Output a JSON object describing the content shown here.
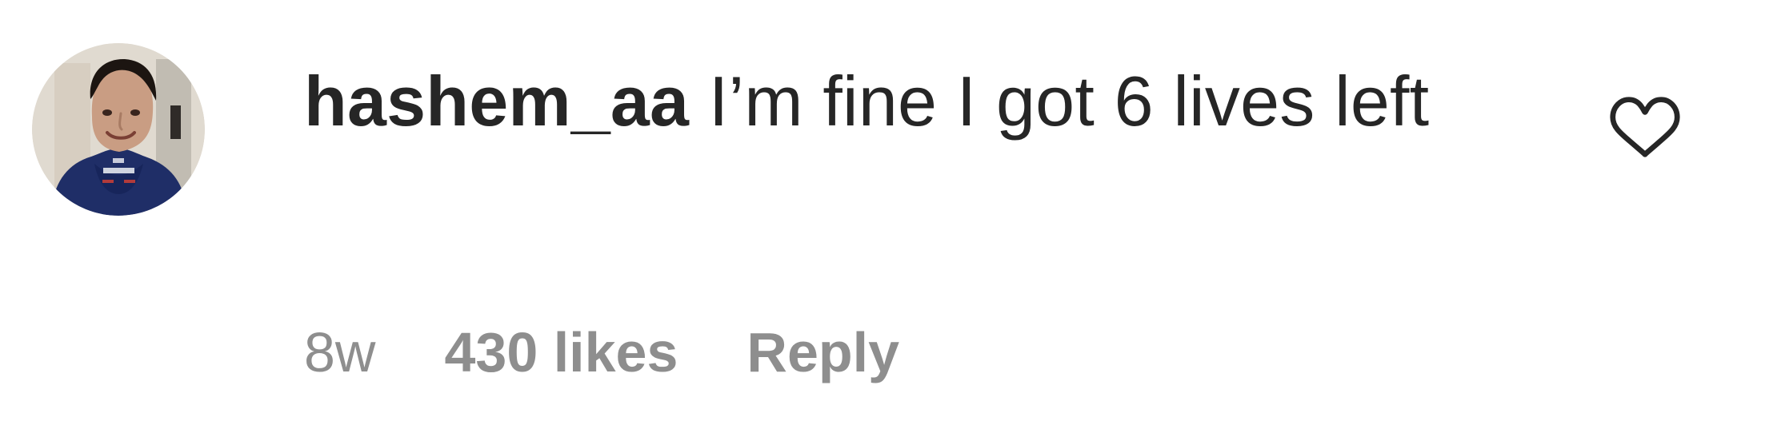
{
  "comment": {
    "username": "hashem_aa",
    "text": "I’m fine I got 6 lives left",
    "avatar_icon": "user-avatar-photo",
    "like_icon": "heart-outline-icon",
    "meta": {
      "timestamp": "8w",
      "likes": "430 likes",
      "reply_label": "Reply"
    }
  },
  "colors": {
    "primary_text": "#262626",
    "secondary_text": "#8e8e8e",
    "background": "#ffffff"
  }
}
